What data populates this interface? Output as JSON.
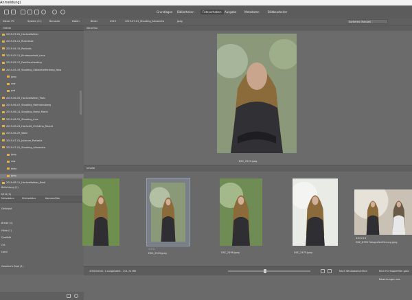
{
  "window": {
    "title": "Anmeldung)"
  },
  "toolbar": {
    "tabs": [
      {
        "label": "Grundlagen"
      },
      {
        "label": "Bibliotheken"
      },
      {
        "label": "Fotovorhaben"
      },
      {
        "label": "Ausgabe"
      },
      {
        "label": "Metadaten"
      },
      {
        "label": "Bildbearbeiter"
      }
    ],
    "active_tab": "Fotovorhaben"
  },
  "pathbar": {
    "crumbs": [
      "Dieser PC",
      "System (C:)",
      "Benutzer",
      "Daten",
      "Bilder",
      "2019",
      "2019-07-01_Shooting_Alexandra",
      "jpeg"
    ],
    "sort_value": "Sortieren: Manuell"
  },
  "folders": {
    "header": "Ordner",
    "items": [
      {
        "label": "2019-07-01_Hochzeitsfeier",
        "indent": 0
      },
      {
        "label": "2019-04-11_Businesse",
        "indent": 0
      },
      {
        "label": "2019-04-15_Portraits",
        "indent": 0
      },
      {
        "label": "2019-05-11_Kinderportrait_Lena",
        "indent": 0
      },
      {
        "label": "2019-05-17_Familienshooting",
        "indent": 0
      },
      {
        "label": "2019-05-19_Shooting_Silberstreifenberg_Nina",
        "indent": 0
      },
      {
        "label": "jpeg",
        "indent": 1
      },
      {
        "label": "raw",
        "indent": 1
      },
      {
        "label": "psd",
        "indent": 1
      },
      {
        "label": "2019-06-05_Hochzeitsfeier_Paris",
        "indent": 0
      },
      {
        "label": "2019-06-07_Shooting_Hofmannsberg",
        "indent": 0
      },
      {
        "label": "2019-06-14_Shooting_Hansi_Maria",
        "indent": 0
      },
      {
        "label": "2019-06-22_Shooting_Ines",
        "indent": 0
      },
      {
        "label": "2019-06-24_Hochzeit_Christina_Marcel",
        "indent": 0
      },
      {
        "label": "2019-06-29_Wald",
        "indent": 0
      },
      {
        "label": "2019-07-01_Julianne_Portraits",
        "indent": 0
      },
      {
        "label": "2019-07-01_Shooting_Alexandra",
        "indent": 0
      },
      {
        "label": "jpeg",
        "indent": 1
      },
      {
        "label": "raw",
        "indent": 1
      },
      {
        "label": "tethr",
        "indent": 1
      },
      {
        "label": "jpeg",
        "indent": 1,
        "selected": true
      },
      {
        "label": "2019-08-11_Hochzeitsfeier_Nadi",
        "indent": 0
      }
    ]
  },
  "panel_tabs": [
    {
      "label": "Metadaten"
    },
    {
      "label": "Stichwörter"
    },
    {
      "label": "Kamerafilter"
    }
  ],
  "metadata": [
    {
      "label": "…"
    },
    {
      "label": "Belichtung (1)"
    },
    {
      "label": "f/1.8 (1)"
    },
    {
      "label": ""
    },
    {
      "label": "Geknipst"
    },
    {
      "label": ""
    },
    {
      "label": "Breite (1)"
    },
    {
      "label": "Höhe (1)"
    },
    {
      "label": "Qualität"
    },
    {
      "label": "Ort"
    },
    {
      "label": "Land"
    },
    {
      "label": ""
    },
    {
      "label": "Caroline's Best (1)"
    }
  ],
  "preview": {
    "header": "Vorschau",
    "filename": "DSC_2519.jpeg"
  },
  "strip": {
    "header": "Inhalte",
    "thumbs": [
      {
        "label": ""
      },
      {
        "label": "DSC_2519.jpeg",
        "rating": "☆☆☆",
        "selected": true
      },
      {
        "label": "DSC_2498.jpeg"
      },
      {
        "label": "DSC_2475.jpeg"
      },
      {
        "label": "DSC_8755 Fotografenführung.jpeg",
        "rating": "★★★★★"
      }
    ]
  },
  "status": {
    "left": "4 Elemente, 1 ausgewählt - 201,72 MB",
    "right1": "Nach Windowansichten",
    "right2": "Klick für Stapelfilter ganz Bewertungen aus"
  }
}
